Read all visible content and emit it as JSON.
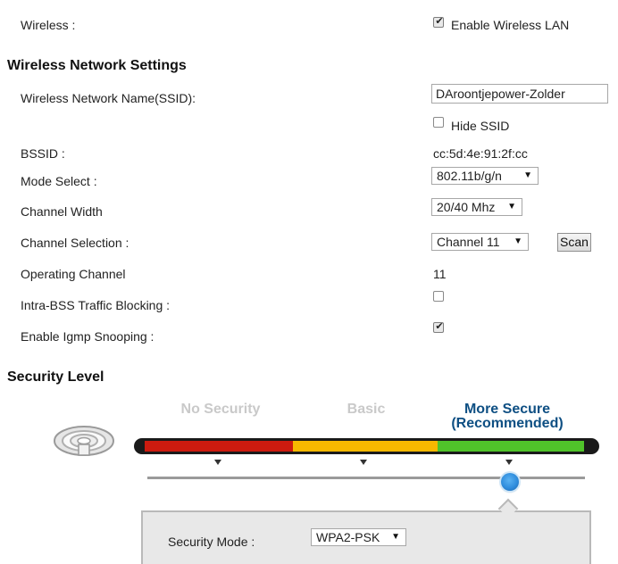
{
  "wireless": {
    "label": "Wireless :",
    "enable_checked": true,
    "enable_label": "Enable Wireless LAN"
  },
  "network_settings": {
    "heading": "Wireless Network Settings",
    "ssid_label": "Wireless Network Name(SSID):",
    "ssid_value": "DAroontjepower-Zolder",
    "hide_ssid_checked": false,
    "hide_ssid_label": "Hide SSID",
    "bssid_label": "BSSID :",
    "bssid_value": "cc:5d:4e:91:2f:cc",
    "mode_label": "Mode Select :",
    "mode_value": "802.11b/g/n",
    "width_label": "Channel Width",
    "width_value": "20/40 Mhz",
    "channel_label": "Channel Selection :",
    "channel_value": "Channel 11",
    "scan_label": "Scan",
    "operating_label": "Operating Channel",
    "operating_value": "11",
    "intra_label": "Intra-BSS Traffic Blocking :",
    "intra_checked": false,
    "igmp_label": "Enable Igmp Snooping :",
    "igmp_checked": true
  },
  "security": {
    "heading": "Security Level",
    "levels": [
      {
        "label": "No Security",
        "active": false
      },
      {
        "label": "Basic",
        "active": false
      },
      {
        "label": "More Secure\n(Recommended)",
        "active": true
      }
    ],
    "level_colors": [
      "#cc1b0f",
      "#f7b800",
      "#50c32a"
    ],
    "selected_level_index": 2,
    "mode_label": "Security Mode :",
    "mode_value": "WPA2-PSK",
    "icon": "wifi-router-icon"
  }
}
